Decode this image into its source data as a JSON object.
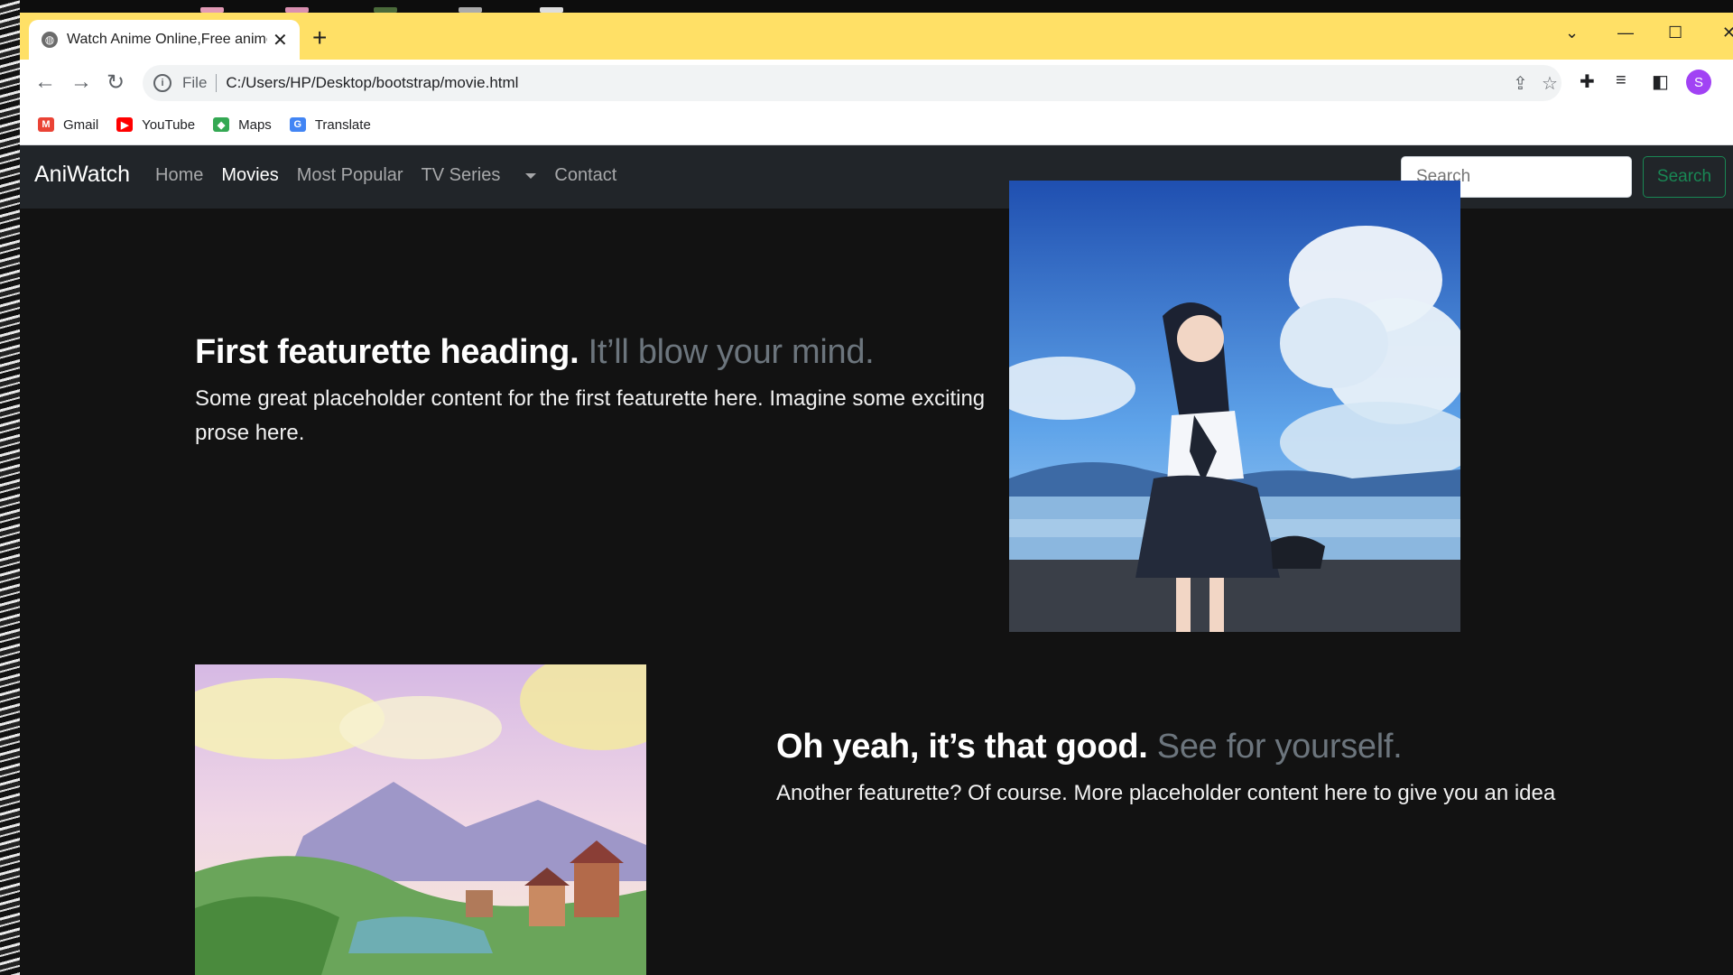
{
  "browser": {
    "tab_title": "Watch Anime Online,Free anime",
    "url_scheme": "File",
    "url": "C:/Users/HP/Desktop/bootstrap/movie.html",
    "avatar_letter": "S",
    "bookmarks": [
      {
        "label": "Gmail",
        "icon": "gmail-icon",
        "color": "#ea4335",
        "glyph": "M"
      },
      {
        "label": "YouTube",
        "icon": "youtube-icon",
        "color": "#ff0000",
        "glyph": "▶"
      },
      {
        "label": "Maps",
        "icon": "maps-icon",
        "color": "#34a853",
        "glyph": "◆"
      },
      {
        "label": "Translate",
        "icon": "translate-icon",
        "color": "#4285f4",
        "glyph": "G"
      }
    ],
    "tabstrip_color": "#ffe066"
  },
  "navbar": {
    "brand": "AniWatch",
    "links": [
      {
        "label": "Home",
        "active": false
      },
      {
        "label": "Movies",
        "active": true
      },
      {
        "label": "Most Popular",
        "active": false
      },
      {
        "label": "TV Series",
        "active": false
      },
      {
        "label": "Contact",
        "active": false
      }
    ],
    "search_placeholder": "Search",
    "search_button": "Search"
  },
  "featurettes": [
    {
      "heading": "First featurette heading.",
      "muted": "It’ll blow your mind.",
      "lead_line1": "Some great placeholder content for the first featurette here. Imagine some exciting",
      "lead_line2": "prose here."
    },
    {
      "heading": "Oh yeah, it’s that good.",
      "muted": "See for yourself.",
      "lead_line1": "Another featurette? Of course. More placeholder content here to give you an idea"
    }
  ],
  "colors": {
    "navbar_bg": "#212529",
    "page_bg": "#121212",
    "success": "#198754",
    "muted": "#6c757d"
  }
}
